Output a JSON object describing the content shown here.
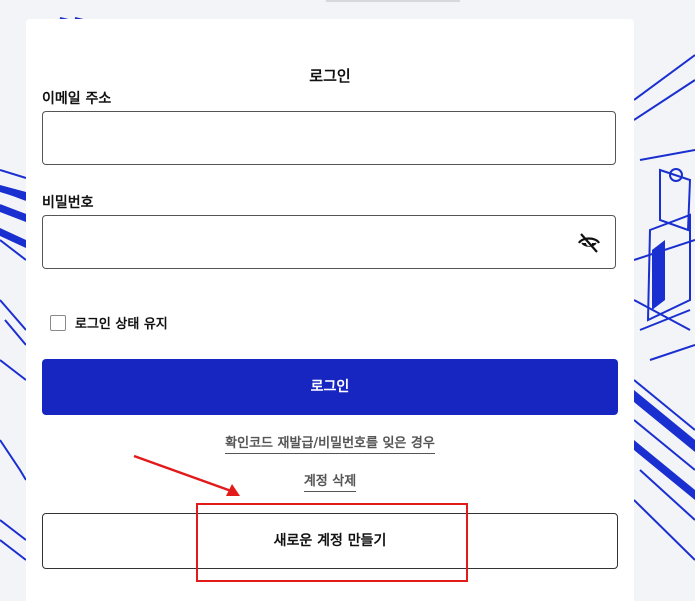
{
  "title": "로그인",
  "email": {
    "label": "이메일 주소",
    "value": "",
    "placeholder": ""
  },
  "password": {
    "label": "비밀번호",
    "value": "",
    "placeholder": "",
    "toggle_icon": "eye-off-icon"
  },
  "remember": {
    "label": "로그인 상태 유지",
    "checked": false
  },
  "login_button": {
    "label": "로그인",
    "color": "#1726c0"
  },
  "links": {
    "reset": "확인코드 재발급/비밀번호를 잊은 경우",
    "delete_account": "계정 삭제"
  },
  "create_account": {
    "label": "새로운 계정 만들기"
  },
  "annotation": {
    "highlight_color": "#e21a1a"
  }
}
